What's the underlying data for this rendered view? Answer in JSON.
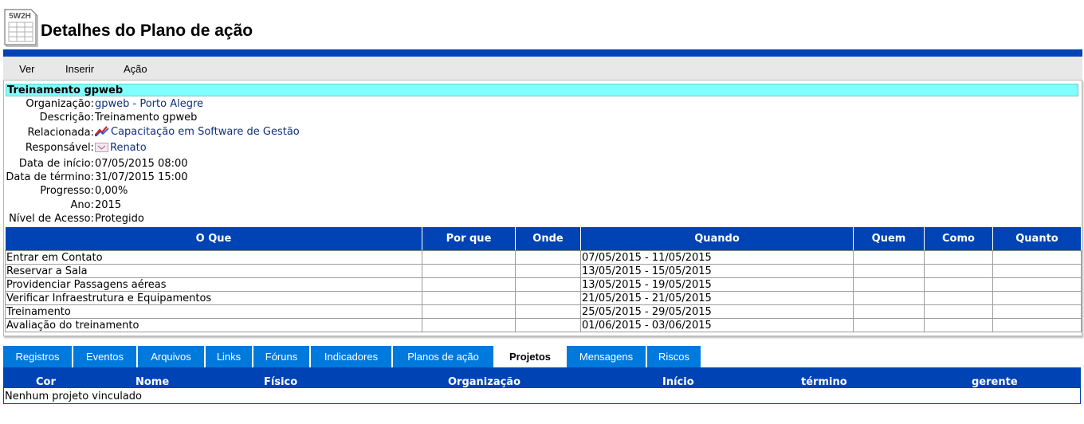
{
  "header": {
    "logo_text": "5W2H",
    "title": "Detalhes do Plano de ação"
  },
  "colors": {
    "primary_blue": "#0043b5",
    "tab_blue": "#0079dd",
    "title_cyan": "#80ffff"
  },
  "menu": {
    "items": [
      "Ver",
      "Inserir",
      "Ação"
    ]
  },
  "plan": {
    "name": "Treinamento gpweb",
    "fields": [
      {
        "label": "Organização:",
        "value": "gpweb - Porto Alegre",
        "icon": ""
      },
      {
        "label": "Descrição:",
        "value": "Treinamento gpweb",
        "icon": ""
      },
      {
        "label": "Relacionada:",
        "value": "Capacitação em Software de Gestão",
        "icon": "project-icon"
      },
      {
        "label": "Responsável:",
        "value": "Renato",
        "icon": "user-icon"
      },
      {
        "label": "Data de início:",
        "value": "07/05/2015 08:00",
        "icon": ""
      },
      {
        "label": "Data de término:",
        "value": "31/07/2015 15:00",
        "icon": ""
      },
      {
        "label": "Progresso:",
        "value": "0,00%",
        "icon": ""
      },
      {
        "label": "Ano:",
        "value": "2015",
        "icon": ""
      },
      {
        "label": "Nível de Acesso:",
        "value": "Protegido",
        "icon": ""
      }
    ]
  },
  "w2h_table": {
    "columns": [
      "O Que",
      "Por que",
      "Onde",
      "Quando",
      "Quem",
      "Como",
      "Quanto"
    ],
    "rows": [
      [
        "Entrar em Contato",
        "",
        "",
        "07/05/2015 - 11/05/2015",
        "",
        "",
        ""
      ],
      [
        "Reservar a Sala",
        "",
        "",
        "13/05/2015 - 15/05/2015",
        "",
        "",
        ""
      ],
      [
        "Providenciar Passagens aéreas",
        "",
        "",
        "13/05/2015 - 19/05/2015",
        "",
        "",
        ""
      ],
      [
        "Verificar Infraestrutura e Equipamentos",
        "",
        "",
        "21/05/2015 - 21/05/2015",
        "",
        "",
        ""
      ],
      [
        "Treinamento",
        "",
        "",
        "25/05/2015 - 29/05/2015",
        "",
        "",
        ""
      ],
      [
        "Avaliação do treinamento",
        "",
        "",
        "01/06/2015 - 03/06/2015",
        "",
        "",
        ""
      ]
    ]
  },
  "tabs": {
    "items": [
      "Registros",
      "Eventos",
      "Arquivos",
      "Links",
      "Fóruns",
      "Indicadores",
      "Planos de ação",
      "Projetos",
      "Mensagens",
      "Riscos"
    ],
    "active": "Projetos"
  },
  "projects": {
    "columns": [
      "Cor",
      "Nome",
      "Físico",
      "Organização",
      "Início",
      "término",
      "gerente"
    ],
    "empty_text": "Nenhum projeto vinculado"
  }
}
